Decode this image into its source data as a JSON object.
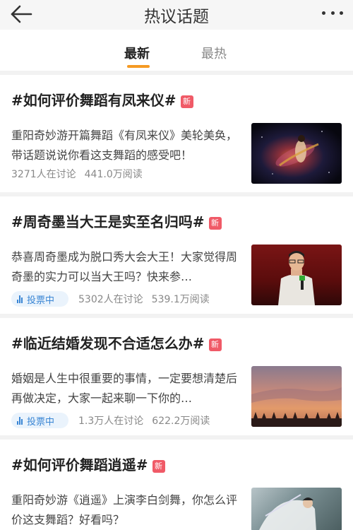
{
  "header": {
    "title": "热议话题"
  },
  "tabs": [
    {
      "label": "最新"
    },
    {
      "label": "最热"
    }
  ],
  "topics": [
    {
      "title": "#如何评价舞蹈有凤来仪#",
      "badge": "新",
      "desc": "重阳奇妙游开篇舞蹈《有凤来仪》美轮美奂，带话题说说你看这支舞蹈的感受吧！",
      "vote_label": "",
      "discuss": "3271人在讨论",
      "reads": "441.0万阅读"
    },
    {
      "title": "#周奇墨当大王是实至名归吗#",
      "badge": "新",
      "desc": "恭喜周奇墨成为脱口秀大会大王！大家觉得周奇墨的实力可以当大王吗？快来参…",
      "vote_label": "投票中",
      "discuss": "5302人在讨论",
      "reads": "539.1万阅读"
    },
    {
      "title": "#临近结婚发现不合适怎么办#",
      "badge": "新",
      "desc": "婚姻是人生中很重要的事情，一定要想清楚后再做决定，大家一起来聊一下你的…",
      "vote_label": "投票中",
      "discuss": "1.3万人在讨论",
      "reads": "622.2万阅读"
    },
    {
      "title": "#如何评价舞蹈逍遥#",
      "badge": "新",
      "desc": "重阳奇妙游《逍遥》上演李白剑舞，你怎么评价这支舞蹈？好看吗？",
      "vote_label": "",
      "discuss": "",
      "reads": ""
    }
  ],
  "colors": {
    "accent": "#f59a23",
    "new_badge": "#f05a67",
    "vote_blue": "#3a86d4"
  },
  "icons": {
    "back": "back-arrow-icon",
    "more": "more-dots-icon",
    "vote": "bar-chart-icon"
  }
}
